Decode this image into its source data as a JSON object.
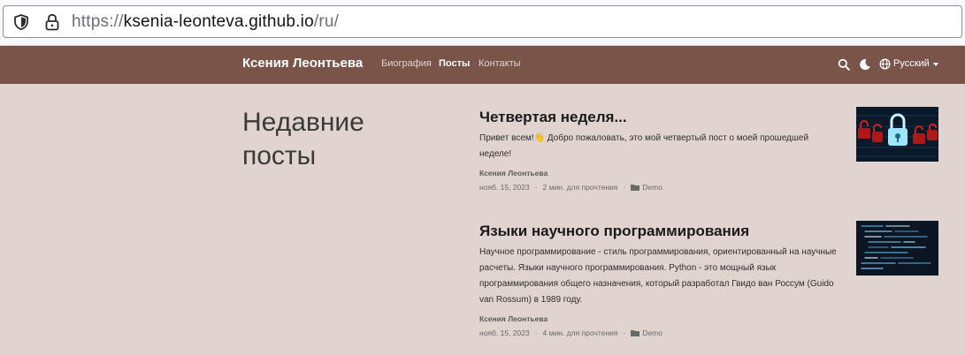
{
  "browser": {
    "url_protocol": "https://",
    "url_host": "ksenia-leonteva.github.io",
    "url_path": "/ru/"
  },
  "navbar": {
    "brand": "Ксения Леонтьева",
    "links": [
      "Биография",
      "Посты",
      "Контакты"
    ],
    "active_link": "Посты",
    "language": "Русский"
  },
  "main": {
    "section_title": "Недавние посты",
    "posts": [
      {
        "title": "Четвертая неделя...",
        "summary": "Привет всем!👋 Добро пожаловать, это мой четвертый пост о моей прошедшей неделе!",
        "author": "Ксения Леонтьева",
        "date": "нояб. 15, 2023",
        "read_time": "2 мин. для прочтения",
        "category": "Demo",
        "thumbnail": "locks-image"
      },
      {
        "title": "Языки научного программирования",
        "summary": "Научное программирование - стиль программирования, ориентированный на научные расчеты. Языки научного программирования. Python - это мощный язык программирования общего назначения, который разработал Гвидо ван Россум (Guido van Rossum) в 1989 году.",
        "author": "Ксения Леонтьева",
        "date": "нояб. 15, 2023",
        "read_time": "4 мин. для прочтения",
        "category": "Demo",
        "thumbnail": "code-screen-image"
      }
    ]
  },
  "colors": {
    "navbar_bg": "#7a5448",
    "page_bg": "#e0d3d0"
  }
}
